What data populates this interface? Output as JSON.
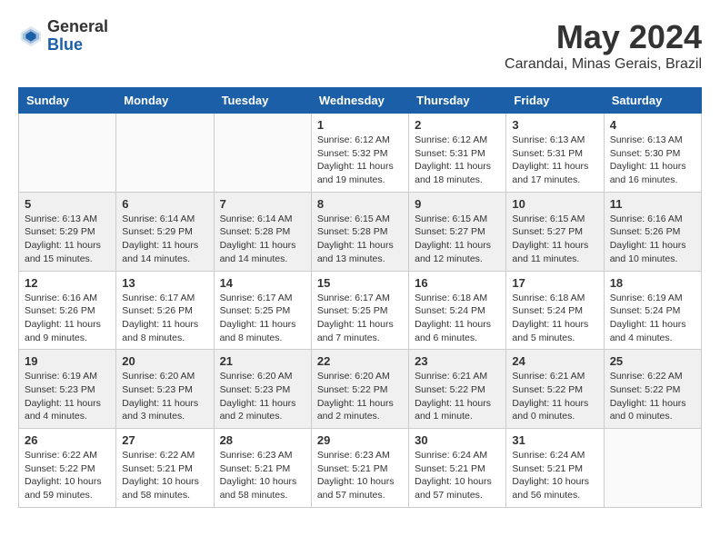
{
  "logo": {
    "general": "General",
    "blue": "Blue"
  },
  "title": "May 2024",
  "location": "Carandai, Minas Gerais, Brazil",
  "headers": [
    "Sunday",
    "Monday",
    "Tuesday",
    "Wednesday",
    "Thursday",
    "Friday",
    "Saturday"
  ],
  "weeks": [
    [
      {
        "day": "",
        "info": ""
      },
      {
        "day": "",
        "info": ""
      },
      {
        "day": "",
        "info": ""
      },
      {
        "day": "1",
        "info": "Sunrise: 6:12 AM\nSunset: 5:32 PM\nDaylight: 11 hours and 19 minutes."
      },
      {
        "day": "2",
        "info": "Sunrise: 6:12 AM\nSunset: 5:31 PM\nDaylight: 11 hours and 18 minutes."
      },
      {
        "day": "3",
        "info": "Sunrise: 6:13 AM\nSunset: 5:31 PM\nDaylight: 11 hours and 17 minutes."
      },
      {
        "day": "4",
        "info": "Sunrise: 6:13 AM\nSunset: 5:30 PM\nDaylight: 11 hours and 16 minutes."
      }
    ],
    [
      {
        "day": "5",
        "info": "Sunrise: 6:13 AM\nSunset: 5:29 PM\nDaylight: 11 hours and 15 minutes."
      },
      {
        "day": "6",
        "info": "Sunrise: 6:14 AM\nSunset: 5:29 PM\nDaylight: 11 hours and 14 minutes."
      },
      {
        "day": "7",
        "info": "Sunrise: 6:14 AM\nSunset: 5:28 PM\nDaylight: 11 hours and 14 minutes."
      },
      {
        "day": "8",
        "info": "Sunrise: 6:15 AM\nSunset: 5:28 PM\nDaylight: 11 hours and 13 minutes."
      },
      {
        "day": "9",
        "info": "Sunrise: 6:15 AM\nSunset: 5:27 PM\nDaylight: 11 hours and 12 minutes."
      },
      {
        "day": "10",
        "info": "Sunrise: 6:15 AM\nSunset: 5:27 PM\nDaylight: 11 hours and 11 minutes."
      },
      {
        "day": "11",
        "info": "Sunrise: 6:16 AM\nSunset: 5:26 PM\nDaylight: 11 hours and 10 minutes."
      }
    ],
    [
      {
        "day": "12",
        "info": "Sunrise: 6:16 AM\nSunset: 5:26 PM\nDaylight: 11 hours and 9 minutes."
      },
      {
        "day": "13",
        "info": "Sunrise: 6:17 AM\nSunset: 5:26 PM\nDaylight: 11 hours and 8 minutes."
      },
      {
        "day": "14",
        "info": "Sunrise: 6:17 AM\nSunset: 5:25 PM\nDaylight: 11 hours and 8 minutes."
      },
      {
        "day": "15",
        "info": "Sunrise: 6:17 AM\nSunset: 5:25 PM\nDaylight: 11 hours and 7 minutes."
      },
      {
        "day": "16",
        "info": "Sunrise: 6:18 AM\nSunset: 5:24 PM\nDaylight: 11 hours and 6 minutes."
      },
      {
        "day": "17",
        "info": "Sunrise: 6:18 AM\nSunset: 5:24 PM\nDaylight: 11 hours and 5 minutes."
      },
      {
        "day": "18",
        "info": "Sunrise: 6:19 AM\nSunset: 5:24 PM\nDaylight: 11 hours and 4 minutes."
      }
    ],
    [
      {
        "day": "19",
        "info": "Sunrise: 6:19 AM\nSunset: 5:23 PM\nDaylight: 11 hours and 4 minutes."
      },
      {
        "day": "20",
        "info": "Sunrise: 6:20 AM\nSunset: 5:23 PM\nDaylight: 11 hours and 3 minutes."
      },
      {
        "day": "21",
        "info": "Sunrise: 6:20 AM\nSunset: 5:23 PM\nDaylight: 11 hours and 2 minutes."
      },
      {
        "day": "22",
        "info": "Sunrise: 6:20 AM\nSunset: 5:22 PM\nDaylight: 11 hours and 2 minutes."
      },
      {
        "day": "23",
        "info": "Sunrise: 6:21 AM\nSunset: 5:22 PM\nDaylight: 11 hours and 1 minute."
      },
      {
        "day": "24",
        "info": "Sunrise: 6:21 AM\nSunset: 5:22 PM\nDaylight: 11 hours and 0 minutes."
      },
      {
        "day": "25",
        "info": "Sunrise: 6:22 AM\nSunset: 5:22 PM\nDaylight: 11 hours and 0 minutes."
      }
    ],
    [
      {
        "day": "26",
        "info": "Sunrise: 6:22 AM\nSunset: 5:22 PM\nDaylight: 10 hours and 59 minutes."
      },
      {
        "day": "27",
        "info": "Sunrise: 6:22 AM\nSunset: 5:21 PM\nDaylight: 10 hours and 58 minutes."
      },
      {
        "day": "28",
        "info": "Sunrise: 6:23 AM\nSunset: 5:21 PM\nDaylight: 10 hours and 58 minutes."
      },
      {
        "day": "29",
        "info": "Sunrise: 6:23 AM\nSunset: 5:21 PM\nDaylight: 10 hours and 57 minutes."
      },
      {
        "day": "30",
        "info": "Sunrise: 6:24 AM\nSunset: 5:21 PM\nDaylight: 10 hours and 57 minutes."
      },
      {
        "day": "31",
        "info": "Sunrise: 6:24 AM\nSunset: 5:21 PM\nDaylight: 10 hours and 56 minutes."
      },
      {
        "day": "",
        "info": ""
      }
    ]
  ]
}
